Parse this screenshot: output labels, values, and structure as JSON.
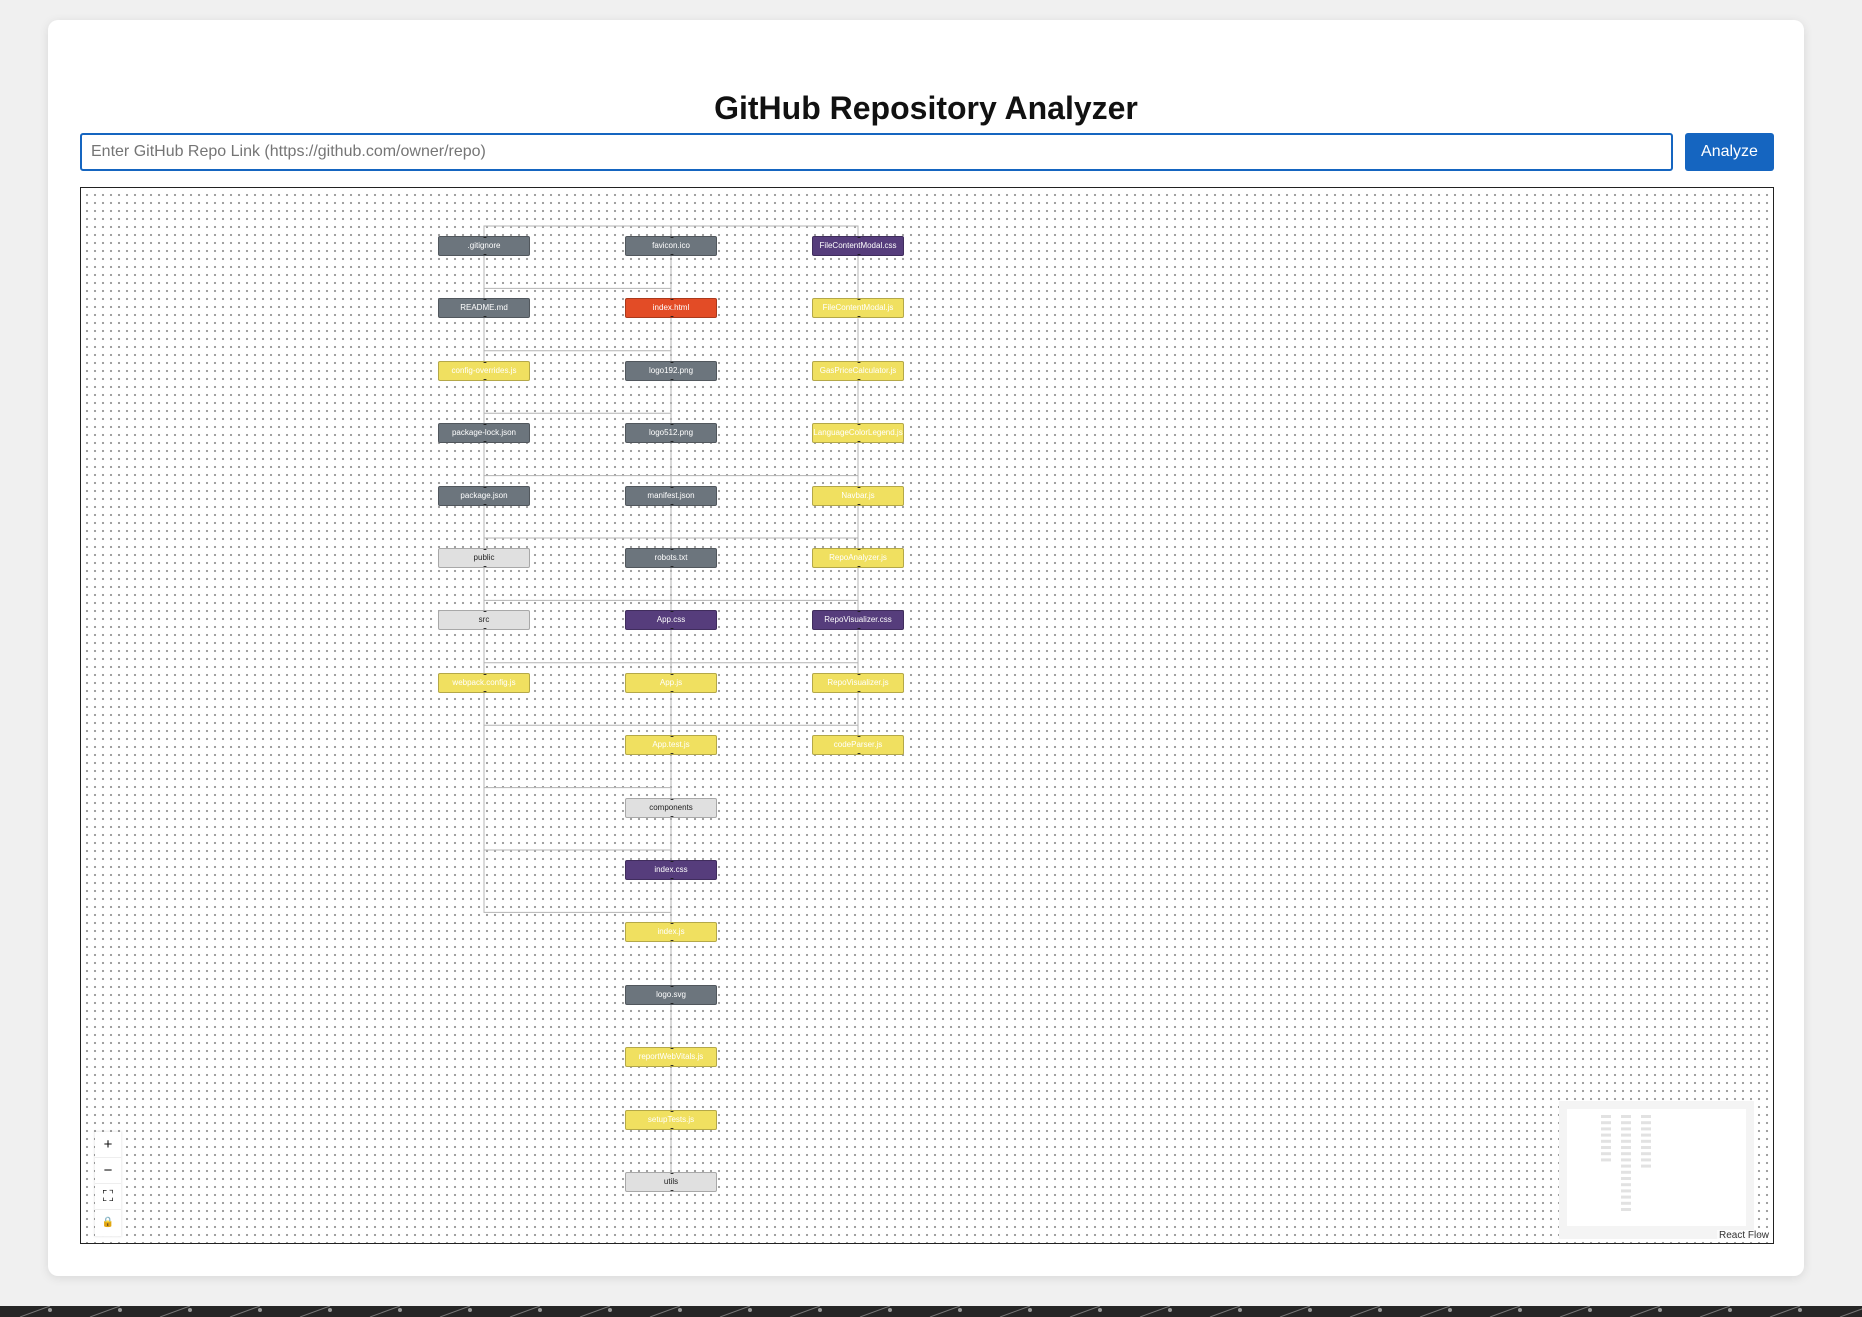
{
  "page": {
    "title": "GitHub Repository Analyzer",
    "search_placeholder": "Enter GitHub Repo Link (https://github.com/owner/repo)",
    "search_value": "",
    "analyze_label": "Analyze",
    "attribution": "React Flow"
  },
  "colors": {
    "primary": "#1565c0",
    "file_default": "#6c757d",
    "folder": "#e0e0e0",
    "javascript": "#f0e060",
    "css": "#563d7c",
    "html": "#e34c26"
  },
  "controls": [
    {
      "name": "zoom-in-icon",
      "glyph": "+"
    },
    {
      "name": "zoom-out-icon",
      "glyph": "−"
    },
    {
      "name": "fit-view-icon",
      "glyph": "⛶"
    },
    {
      "name": "lock-icon",
      "glyph": "🔒"
    }
  ],
  "nodes": [
    {
      "label": ".gitignore",
      "type": "file",
      "col": 0,
      "row": 0
    },
    {
      "label": "README.md",
      "type": "file",
      "col": 0,
      "row": 1
    },
    {
      "label": "config-overrides.js",
      "type": "js",
      "col": 0,
      "row": 2
    },
    {
      "label": "package-lock.json",
      "type": "file",
      "col": 0,
      "row": 3
    },
    {
      "label": "package.json",
      "type": "file",
      "col": 0,
      "row": 4
    },
    {
      "label": "public",
      "type": "folder",
      "col": 0,
      "row": 5
    },
    {
      "label": "src",
      "type": "folder",
      "col": 0,
      "row": 6
    },
    {
      "label": "webpack.config.js",
      "type": "js",
      "col": 0,
      "row": 7
    },
    {
      "label": "favicon.ico",
      "type": "file",
      "col": 1,
      "row": 0
    },
    {
      "label": "index.html",
      "type": "html",
      "col": 1,
      "row": 1
    },
    {
      "label": "logo192.png",
      "type": "file",
      "col": 1,
      "row": 2
    },
    {
      "label": "logo512.png",
      "type": "file",
      "col": 1,
      "row": 3
    },
    {
      "label": "manifest.json",
      "type": "file",
      "col": 1,
      "row": 4
    },
    {
      "label": "robots.txt",
      "type": "file",
      "col": 1,
      "row": 5
    },
    {
      "label": "App.css",
      "type": "css",
      "col": 1,
      "row": 6
    },
    {
      "label": "App.js",
      "type": "js",
      "col": 1,
      "row": 7
    },
    {
      "label": "App.test.js",
      "type": "js",
      "col": 1,
      "row": 8
    },
    {
      "label": "components",
      "type": "folder",
      "col": 1,
      "row": 9
    },
    {
      "label": "index.css",
      "type": "css",
      "col": 1,
      "row": 10
    },
    {
      "label": "index.js",
      "type": "js",
      "col": 1,
      "row": 11
    },
    {
      "label": "logo.svg",
      "type": "file",
      "col": 1,
      "row": 12
    },
    {
      "label": "reportWebVitals.js",
      "type": "js",
      "col": 1,
      "row": 13
    },
    {
      "label": "setupTests.js",
      "type": "js",
      "col": 1,
      "row": 14
    },
    {
      "label": "utils",
      "type": "folder",
      "col": 1,
      "row": 15
    },
    {
      "label": "FileContentModal.css",
      "type": "css",
      "col": 2,
      "row": 0
    },
    {
      "label": "FileContentModal.js",
      "type": "js",
      "col": 2,
      "row": 1
    },
    {
      "label": "GasPriceCalculator.js",
      "type": "js",
      "col": 2,
      "row": 2
    },
    {
      "label": "LanguageColorLegend.js",
      "type": "js",
      "col": 2,
      "row": 3
    },
    {
      "label": "Navbar.js",
      "type": "js",
      "col": 2,
      "row": 4
    },
    {
      "label": "RepoAnalyzer.js",
      "type": "js",
      "col": 2,
      "row": 5
    },
    {
      "label": "RepoVisualizer.css",
      "type": "css",
      "col": 2,
      "row": 6
    },
    {
      "label": "RepoVisualizer.js",
      "type": "js",
      "col": 2,
      "row": 7
    },
    {
      "label": "codeParser.js",
      "type": "js",
      "col": 2,
      "row": 8
    }
  ]
}
